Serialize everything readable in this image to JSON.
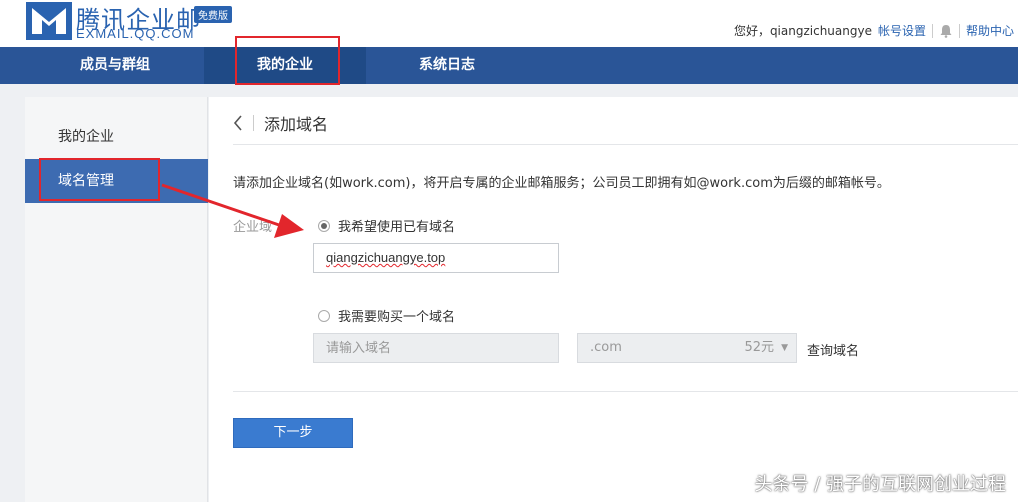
{
  "header": {
    "logo_title": "腾讯企业邮",
    "logo_sub": "EXMAIL.QQ.COM",
    "logo_badge": "免费版",
    "greeting": "您好，qiangzichuangye",
    "account_settings": "帐号设置",
    "help_center": "帮助中心"
  },
  "nav": {
    "tabs": [
      {
        "label": "成员与群组"
      },
      {
        "label": "我的企业"
      },
      {
        "label": "系统日志"
      }
    ],
    "active_index": 1
  },
  "sidebar": {
    "items": [
      {
        "label": "我的企业"
      },
      {
        "label": "域名管理"
      }
    ],
    "active_index": 1
  },
  "main": {
    "title": "添加域名",
    "description": "请添加企业域名(如work.com)，将开启专属的企业邮箱服务；公司员工即拥有如@work.com为后缀的邮箱帐号。",
    "field_label": "企业域",
    "option_existing": "我希望使用已有域名",
    "existing_domain_value": "qiangzichuangye.top",
    "option_buy": "我需要购买一个域名",
    "buy_placeholder": "请输入域名",
    "buy_suffix": ".com",
    "buy_price": "52元",
    "query_label": "查询域名",
    "next_button": "下一步"
  },
  "watermark": "头条号 / 强子的互联网创业过程",
  "colors": {
    "nav_bg": "#2a5597",
    "accent": "#3a7bd0",
    "highlight": "#e2262c"
  }
}
